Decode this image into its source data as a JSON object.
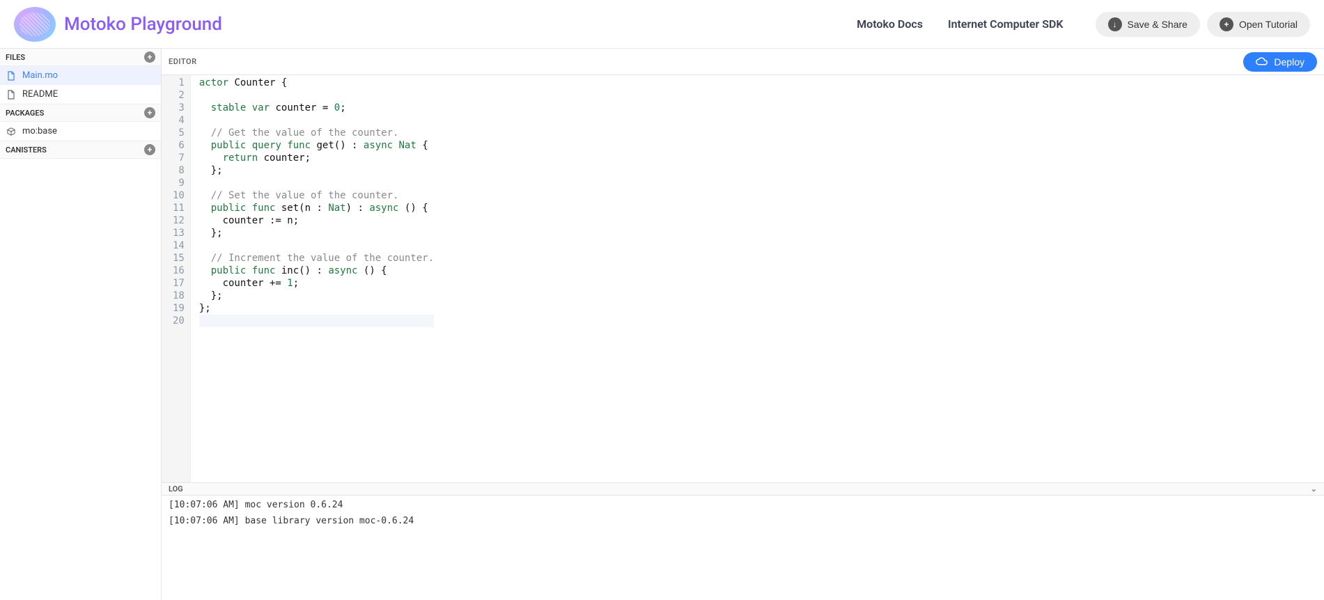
{
  "header": {
    "title": "Motoko Playground",
    "links": {
      "docs": "Motoko Docs",
      "sdk": "Internet Computer SDK"
    },
    "save_share": "Save & Share",
    "open_tutorial": "Open Tutorial"
  },
  "sidebar": {
    "files_label": "FILES",
    "packages_label": "PACKAGES",
    "canisters_label": "CANISTERS",
    "files": [
      {
        "name": "Main.mo",
        "active": true
      },
      {
        "name": "README",
        "active": false
      }
    ],
    "packages": [
      {
        "name": "mo:base"
      }
    ],
    "canisters": []
  },
  "editor": {
    "label": "EDITOR",
    "deploy_label": "Deploy",
    "lines": [
      [
        {
          "t": "actor",
          "c": "kw"
        },
        {
          "t": " Counter {",
          "c": ""
        }
      ],
      [],
      [
        {
          "t": "  ",
          "c": ""
        },
        {
          "t": "stable",
          "c": "kw"
        },
        {
          "t": " ",
          "c": ""
        },
        {
          "t": "var",
          "c": "kw"
        },
        {
          "t": " counter = ",
          "c": ""
        },
        {
          "t": "0",
          "c": "num"
        },
        {
          "t": ";",
          "c": ""
        }
      ],
      [],
      [
        {
          "t": "  ",
          "c": ""
        },
        {
          "t": "// Get the value of the counter.",
          "c": "cmt"
        }
      ],
      [
        {
          "t": "  ",
          "c": ""
        },
        {
          "t": "public",
          "c": "kw"
        },
        {
          "t": " ",
          "c": ""
        },
        {
          "t": "query",
          "c": "kw"
        },
        {
          "t": " ",
          "c": ""
        },
        {
          "t": "func",
          "c": "kw"
        },
        {
          "t": " get() : ",
          "c": ""
        },
        {
          "t": "async",
          "c": "kw"
        },
        {
          "t": " ",
          "c": ""
        },
        {
          "t": "Nat",
          "c": "type"
        },
        {
          "t": " {",
          "c": ""
        }
      ],
      [
        {
          "t": "    ",
          "c": ""
        },
        {
          "t": "return",
          "c": "kw"
        },
        {
          "t": " counter;",
          "c": ""
        }
      ],
      [
        {
          "t": "  };",
          "c": ""
        }
      ],
      [],
      [
        {
          "t": "  ",
          "c": ""
        },
        {
          "t": "// Set the value of the counter.",
          "c": "cmt"
        }
      ],
      [
        {
          "t": "  ",
          "c": ""
        },
        {
          "t": "public",
          "c": "kw"
        },
        {
          "t": " ",
          "c": ""
        },
        {
          "t": "func",
          "c": "kw"
        },
        {
          "t": " set(n : ",
          "c": ""
        },
        {
          "t": "Nat",
          "c": "type"
        },
        {
          "t": ") : ",
          "c": ""
        },
        {
          "t": "async",
          "c": "kw"
        },
        {
          "t": " () {",
          "c": ""
        }
      ],
      [
        {
          "t": "    counter := n;",
          "c": ""
        }
      ],
      [
        {
          "t": "  };",
          "c": ""
        }
      ],
      [],
      [
        {
          "t": "  ",
          "c": ""
        },
        {
          "t": "// Increment the value of the counter.",
          "c": "cmt"
        }
      ],
      [
        {
          "t": "  ",
          "c": ""
        },
        {
          "t": "public",
          "c": "kw"
        },
        {
          "t": " ",
          "c": ""
        },
        {
          "t": "func",
          "c": "kw"
        },
        {
          "t": " inc() : ",
          "c": ""
        },
        {
          "t": "async",
          "c": "kw"
        },
        {
          "t": " () {",
          "c": ""
        }
      ],
      [
        {
          "t": "    counter += ",
          "c": ""
        },
        {
          "t": "1",
          "c": "num"
        },
        {
          "t": ";",
          "c": ""
        }
      ],
      [
        {
          "t": "  };",
          "c": ""
        }
      ],
      [
        {
          "t": "};",
          "c": ""
        }
      ],
      []
    ],
    "current_line_index": 19
  },
  "log": {
    "label": "LOG",
    "entries": [
      "[10:07:06 AM] moc version 0.6.24",
      "[10:07:06 AM] base library version moc-0.6.24"
    ]
  }
}
